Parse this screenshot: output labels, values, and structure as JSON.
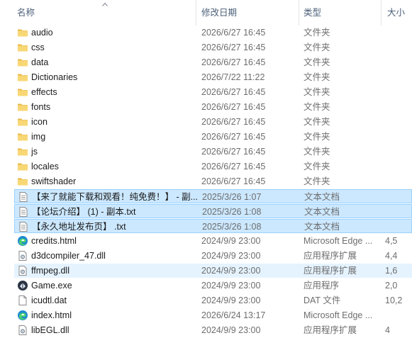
{
  "columns": {
    "name": "名称",
    "date": "修改日期",
    "type": "类型",
    "size": "大小"
  },
  "rows": [
    {
      "name": "audio",
      "date": "2026/6/27 16:45",
      "type": "文件夹",
      "size": "",
      "icon": "folder-icon",
      "state": ""
    },
    {
      "name": "css",
      "date": "2026/6/27 16:45",
      "type": "文件夹",
      "size": "",
      "icon": "folder-icon",
      "state": ""
    },
    {
      "name": "data",
      "date": "2026/6/27 16:45",
      "type": "文件夹",
      "size": "",
      "icon": "folder-icon",
      "state": ""
    },
    {
      "name": "Dictionaries",
      "date": "2026/7/22 11:22",
      "type": "文件夹",
      "size": "",
      "icon": "folder-icon",
      "state": ""
    },
    {
      "name": "effects",
      "date": "2026/6/27 16:45",
      "type": "文件夹",
      "size": "",
      "icon": "folder-icon",
      "state": ""
    },
    {
      "name": "fonts",
      "date": "2026/6/27 16:45",
      "type": "文件夹",
      "size": "",
      "icon": "folder-icon",
      "state": ""
    },
    {
      "name": "icon",
      "date": "2026/6/27 16:45",
      "type": "文件夹",
      "size": "",
      "icon": "folder-icon",
      "state": ""
    },
    {
      "name": "img",
      "date": "2026/6/27 16:45",
      "type": "文件夹",
      "size": "",
      "icon": "folder-icon",
      "state": ""
    },
    {
      "name": "js",
      "date": "2026/6/27 16:45",
      "type": "文件夹",
      "size": "",
      "icon": "folder-icon",
      "state": ""
    },
    {
      "name": "locales",
      "date": "2026/6/27 16:45",
      "type": "文件夹",
      "size": "",
      "icon": "folder-icon",
      "state": ""
    },
    {
      "name": "swiftshader",
      "date": "2026/6/27 16:45",
      "type": "文件夹",
      "size": "",
      "icon": "folder-icon",
      "state": ""
    },
    {
      "name": "【来了就能下载和观看！纯免费！】 - 副...",
      "date": "2025/3/26 1:07",
      "type": "文本文档",
      "size": "",
      "icon": "text-file-icon",
      "state": "selected"
    },
    {
      "name": "【论坛介绍】 (1) - 副本.txt",
      "date": "2025/3/26 1:08",
      "type": "文本文档",
      "size": "",
      "icon": "text-file-icon",
      "state": "selected"
    },
    {
      "name": "【永久地址发布页】 .txt",
      "date": "2025/3/26 1:08",
      "type": "文本文档",
      "size": "",
      "icon": "text-file-icon",
      "state": "selected"
    },
    {
      "name": "credits.html",
      "date": "2024/9/9 23:00",
      "type": "Microsoft Edge ...",
      "size": "4,5",
      "icon": "edge-icon",
      "state": ""
    },
    {
      "name": "d3dcompiler_47.dll",
      "date": "2024/9/9 23:00",
      "type": "应用程序扩展",
      "size": "4,4",
      "icon": "dll-icon",
      "state": ""
    },
    {
      "name": "ffmpeg.dll",
      "date": "2024/9/9 23:00",
      "type": "应用程序扩展",
      "size": "1,6",
      "icon": "dll-icon",
      "state": "hover"
    },
    {
      "name": "Game.exe",
      "date": "2024/9/9 23:00",
      "type": "应用程序",
      "size": "2,0",
      "icon": "exe-icon",
      "state": ""
    },
    {
      "name": "icudtl.dat",
      "date": "2024/9/9 23:00",
      "type": "DAT 文件",
      "size": "10,2",
      "icon": "dat-file-icon",
      "state": ""
    },
    {
      "name": "index.html",
      "date": "2026/6/24 13:17",
      "type": "Microsoft Edge ...",
      "size": "",
      "icon": "edge-icon",
      "state": ""
    },
    {
      "name": "libEGL.dll",
      "date": "2024/9/9 23:00",
      "type": "应用程序扩展",
      "size": "4",
      "icon": "dll-icon",
      "state": ""
    }
  ]
}
